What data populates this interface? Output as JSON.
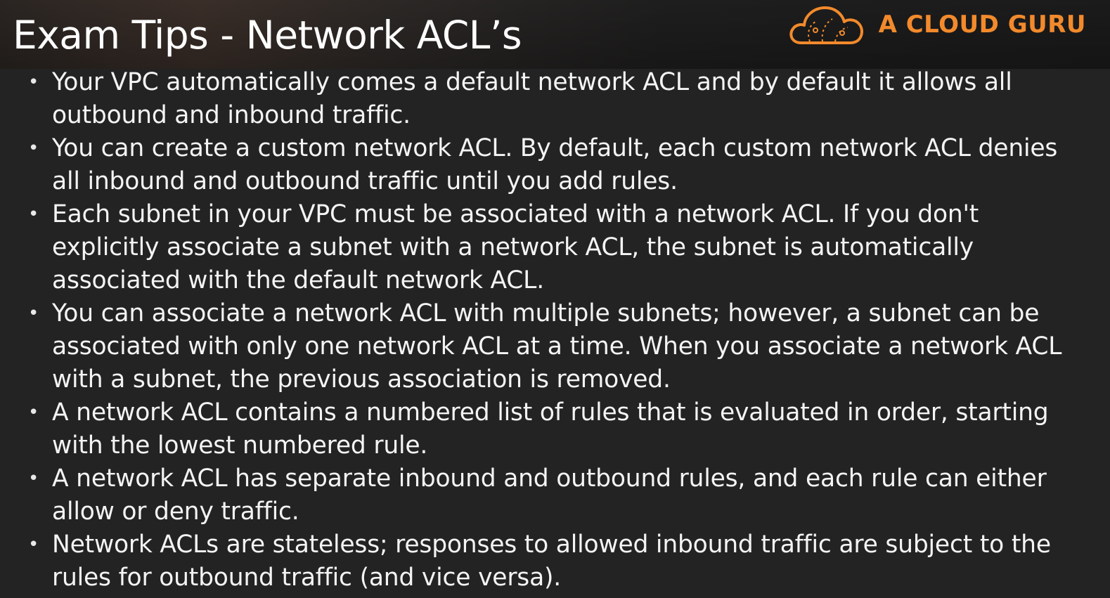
{
  "header": {
    "title": "Exam Tips - Network ACL’s",
    "logo_text": "A CLOUD GURU",
    "logo_icon": "cloud-logo-icon",
    "brand_color": "#f28a2c"
  },
  "tips": [
    "Your VPC automatically comes a default network ACL and by default it allows all outbound and inbound traffic.",
    "You can create a custom network ACL. By default, each custom network ACL denies all inbound and outbound traffic until you add rules.",
    "Each subnet in your VPC must be associated with a network ACL. If you don't explicitly associate a subnet with a network ACL, the subnet is automatically associated with the default network ACL.",
    "You can associate a network ACL with multiple subnets; however, a subnet can be associated with only one network ACL at a time. When you associate a network ACL with a subnet, the previous association is removed.",
    "A network ACL contains a numbered list of rules that is evaluated in order, starting with the lowest numbered rule.",
    "A network ACL has separate inbound and outbound rules, and each rule can either allow or deny traffic.",
    "Network ACLs are stateless; responses to allowed inbound traffic are subject to the rules for outbound traffic (and vice versa)."
  ],
  "bullet_glyph": "•"
}
